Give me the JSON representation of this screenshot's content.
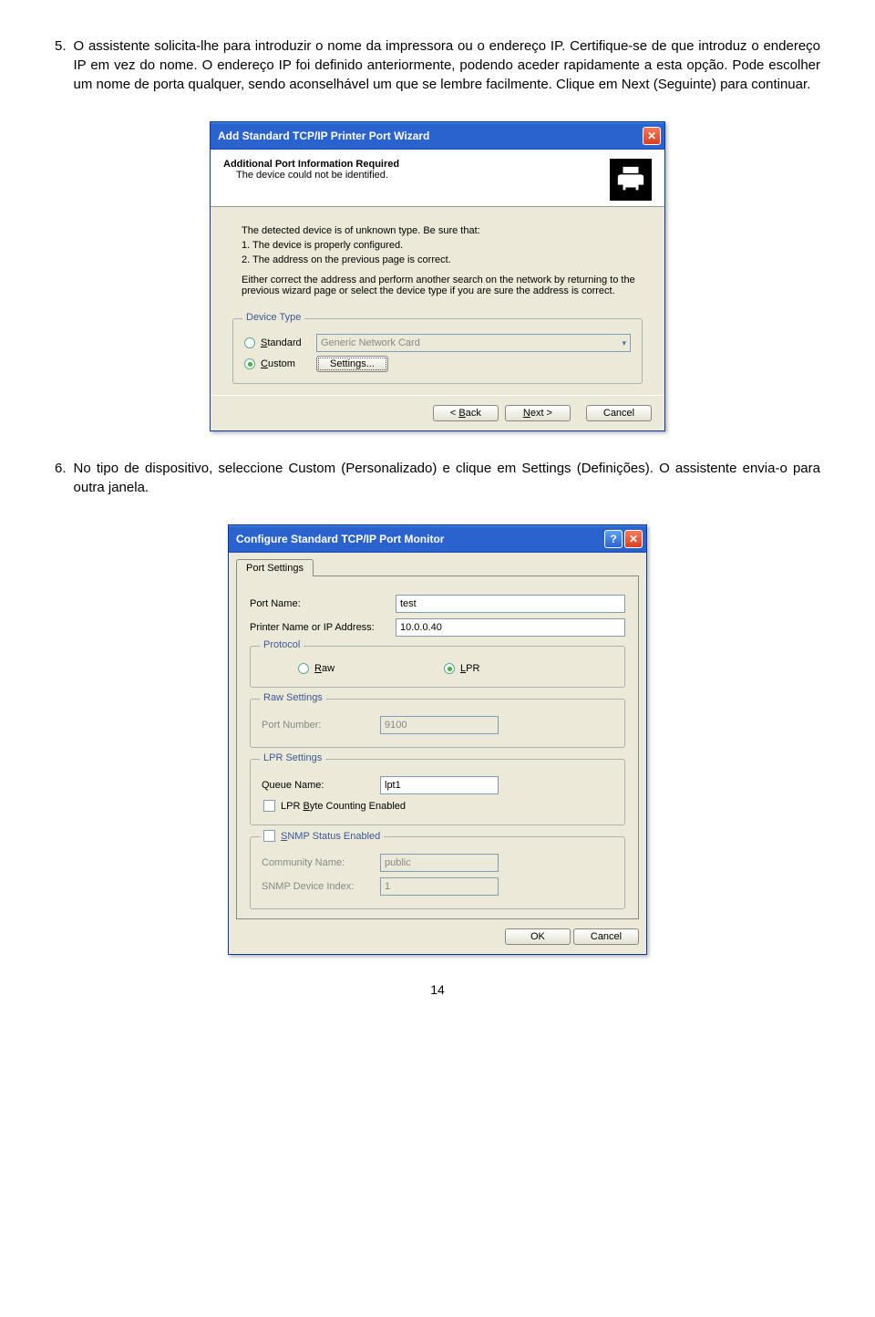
{
  "doc": {
    "para5_num": "5.",
    "para5": "O assistente solicita-lhe para introduzir o nome da impressora ou o endereço IP. Certifique-se de que introduz o endereço IP em vez do nome.   O endereço IP foi definido anteriormente, podendo aceder rapidamente a esta opção.  Pode escolher um nome de porta qualquer, sendo aconselhável um que se lembre facilmente.   Clique em Next (Seguinte) para continuar.",
    "para6_num": "6.",
    "para6": "No tipo de dispositivo, seleccione Custom (Personalizado) e clique em Settings (Definições). O assistente envia-o para outra janela.",
    "page_number": "14"
  },
  "wizard1": {
    "title": "Add Standard TCP/IP Printer Port Wizard",
    "heading": "Additional Port Information Required",
    "subheading": "The device could not be identified.",
    "body_line1": "The detected device is of unknown type.  Be sure that:",
    "body_line2": "1.  The device is properly configured.",
    "body_line3": "2.  The address on the previous page is correct.",
    "body_line4": "Either correct the address and perform another search on the network by returning to the previous wizard page or select the device type if you are sure the address is correct.",
    "group_title": "Device Type",
    "radio_standard": "Standard",
    "standard_value": "Generic Network Card",
    "radio_custom": "Custom",
    "settings_btn": "Settings...",
    "back": "< Back",
    "next": "Next >",
    "cancel": "Cancel"
  },
  "wizard2": {
    "title": "Configure Standard TCP/IP Port Monitor",
    "tab": "Port Settings",
    "port_name_label": "Port Name:",
    "port_name": "test",
    "ip_label": "Printer Name or IP Address:",
    "ip": "10.0.0.40",
    "protocol_group": "Protocol",
    "raw": "Raw",
    "lpr": "LPR",
    "raw_group": "Raw Settings",
    "raw_port_label": "Port Number:",
    "raw_port": "9100",
    "lpr_group": "LPR Settings",
    "queue_label": "Queue Name:",
    "queue": "lpt1",
    "lpr_checkbox": "LPR Byte Counting Enabled",
    "snmp_group": "SNMP Status Enabled",
    "community_label": "Community Name:",
    "community": "public",
    "snmp_idx_label": "SNMP Device Index:",
    "snmp_idx": "1",
    "ok": "OK",
    "cancel": "Cancel"
  }
}
